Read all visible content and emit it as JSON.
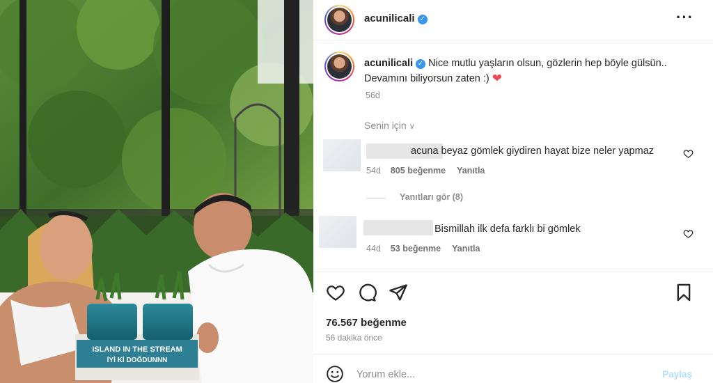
{
  "post": {
    "username": "acunilicali",
    "verified": true,
    "caption_text": "Nice mutlu yaşların olsun, gözlerin hep böyle gülsün.. Devamını biliyorsun zaten :)",
    "caption_emoji": "❤",
    "caption_time": "56d",
    "photo_cake_line1": "ISLAND IN THE STREAM",
    "photo_cake_line2": "İYİ Kİ DOĞDUNNN"
  },
  "comments_filter": "Senin için",
  "comments": [
    {
      "text": "acuna beyaz gömlek giydiren hayat bize neler yapmaz",
      "time": "54d",
      "likes": "805 beğenme",
      "reply": "Yanıtla"
    },
    {
      "text": "Bismillah ilk defa farklı bi gömlek",
      "time": "44d",
      "likes": "53 beğenme",
      "reply": "Yanıtla"
    }
  ],
  "view_replies": "Yanıtları gör (8)",
  "likes_count": "76.567 beğenme",
  "posted_ago": "56 dakika önce",
  "comment_input": {
    "placeholder": "Yorum ekle...",
    "value": ""
  },
  "share_label": "Paylaş",
  "icons": [
    "more-icon",
    "heart-icon",
    "comment-icon",
    "share-icon",
    "bookmark-icon",
    "emoji-icon",
    "verified-icon"
  ],
  "colors": {
    "verified": "#3897f0",
    "heart": "#ed4956",
    "muted_text": "#8e8e8e",
    "share_disabled": "#b2dffc"
  }
}
